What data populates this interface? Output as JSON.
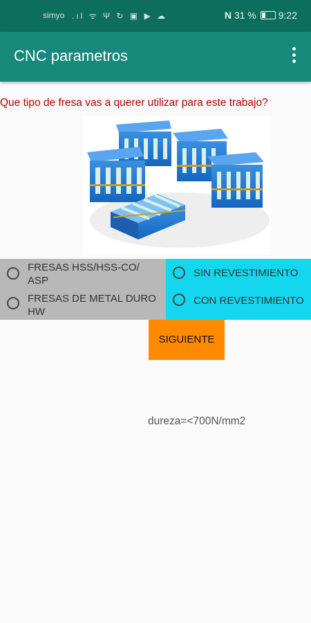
{
  "status_bar": {
    "carrier": "simyo",
    "icons": [
      "signal-icon",
      "wifi-icon",
      "usb-icon",
      "sync-icon",
      "image-icon",
      "play-icon",
      "cloud-icon"
    ],
    "nfc": "N",
    "battery": "31 %",
    "time": "9:22"
  },
  "app_bar": {
    "title": "CNC parametros",
    "menu_icon": "more-vert-icon",
    "color": "#16897a"
  },
  "question": "Que tipo de fresa vas a querer utilizar para este trabajo?",
  "image": {
    "description_icon": "milling-cutter-boxes-image"
  },
  "tool_type": {
    "options": [
      {
        "line1": "FRESAS HSS/HSS-CO/",
        "line2": "ASP"
      },
      {
        "line1": "FRESAS DE METAL DURO",
        "line2": "HW"
      }
    ],
    "color": "#b8b8b8"
  },
  "coating": {
    "options": [
      {
        "label": "SIN REVESTIMIENTO"
      },
      {
        "label": "CON REVESTIMIENTO"
      }
    ],
    "color": "#14d6ef"
  },
  "next_button": {
    "label": "SIGUIENTE",
    "color": "#ff8a00"
  },
  "info_text": "dureza=<700N/mm2"
}
